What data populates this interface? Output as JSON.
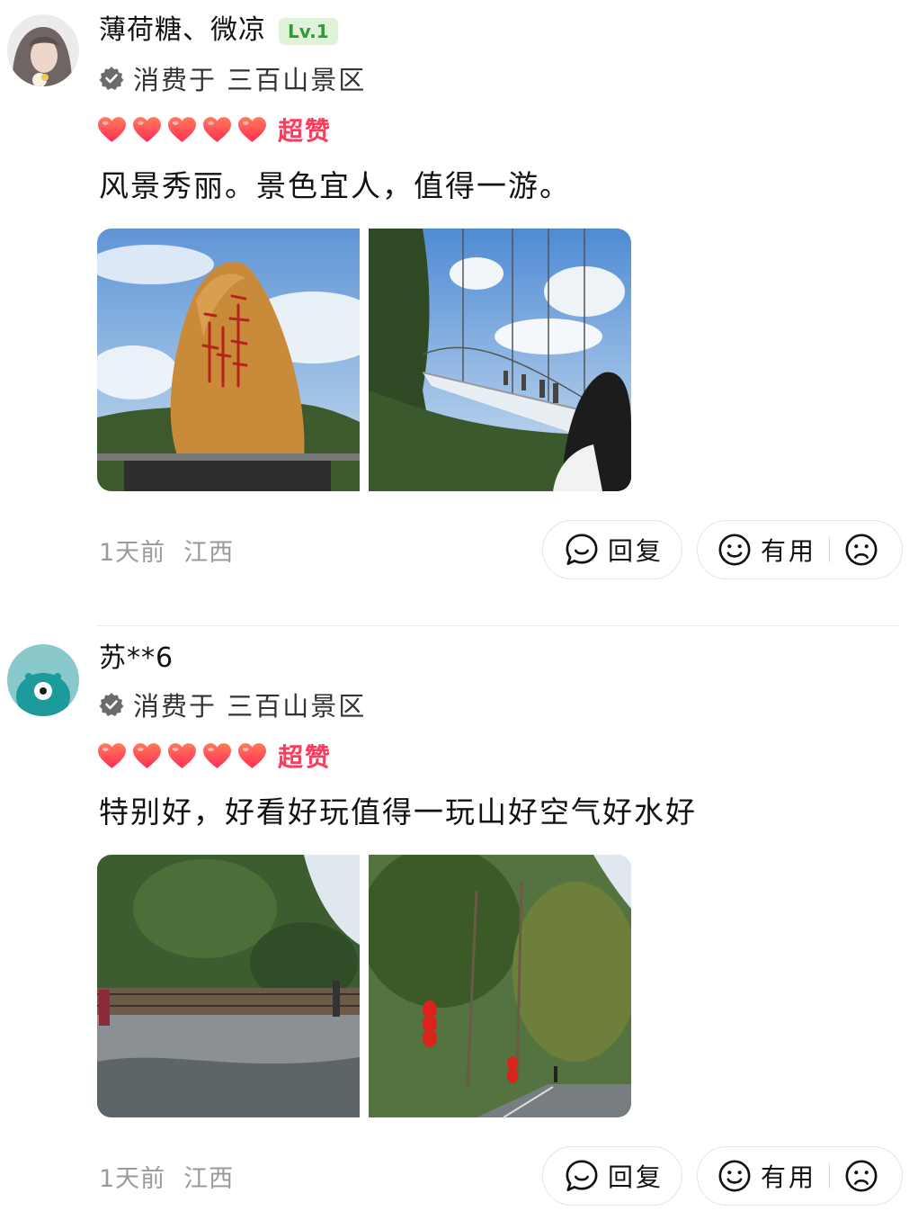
{
  "reviews": [
    {
      "username": "薄荷糖、微凉",
      "level": "Lv.1",
      "verified_text": "消费于 三百山景区",
      "rating_label": "超赞",
      "stars": 5,
      "content": "风景秀丽。景色宜人，值得一游。",
      "time": "1天前",
      "location": "江西",
      "reply_label": "回复",
      "useful_label": "有用"
    },
    {
      "username": "苏**6",
      "verified_text": "消费于 三百山景区",
      "rating_label": "超赞",
      "stars": 5,
      "content": "特别好，好看好玩值得一玩山好空气好水好",
      "time": "1天前",
      "location": "江西",
      "reply_label": "回复",
      "useful_label": "有用"
    }
  ],
  "colors": {
    "heart": "#ff3b4e",
    "rating_text": "#ff3b5b",
    "level_bg": "#dff3d8",
    "level_text": "#2f9a3a",
    "meta_text": "#9a9a9a"
  },
  "icons": [
    "verified-icon",
    "heart-icon",
    "comment-icon",
    "smile-icon",
    "frown-icon"
  ]
}
